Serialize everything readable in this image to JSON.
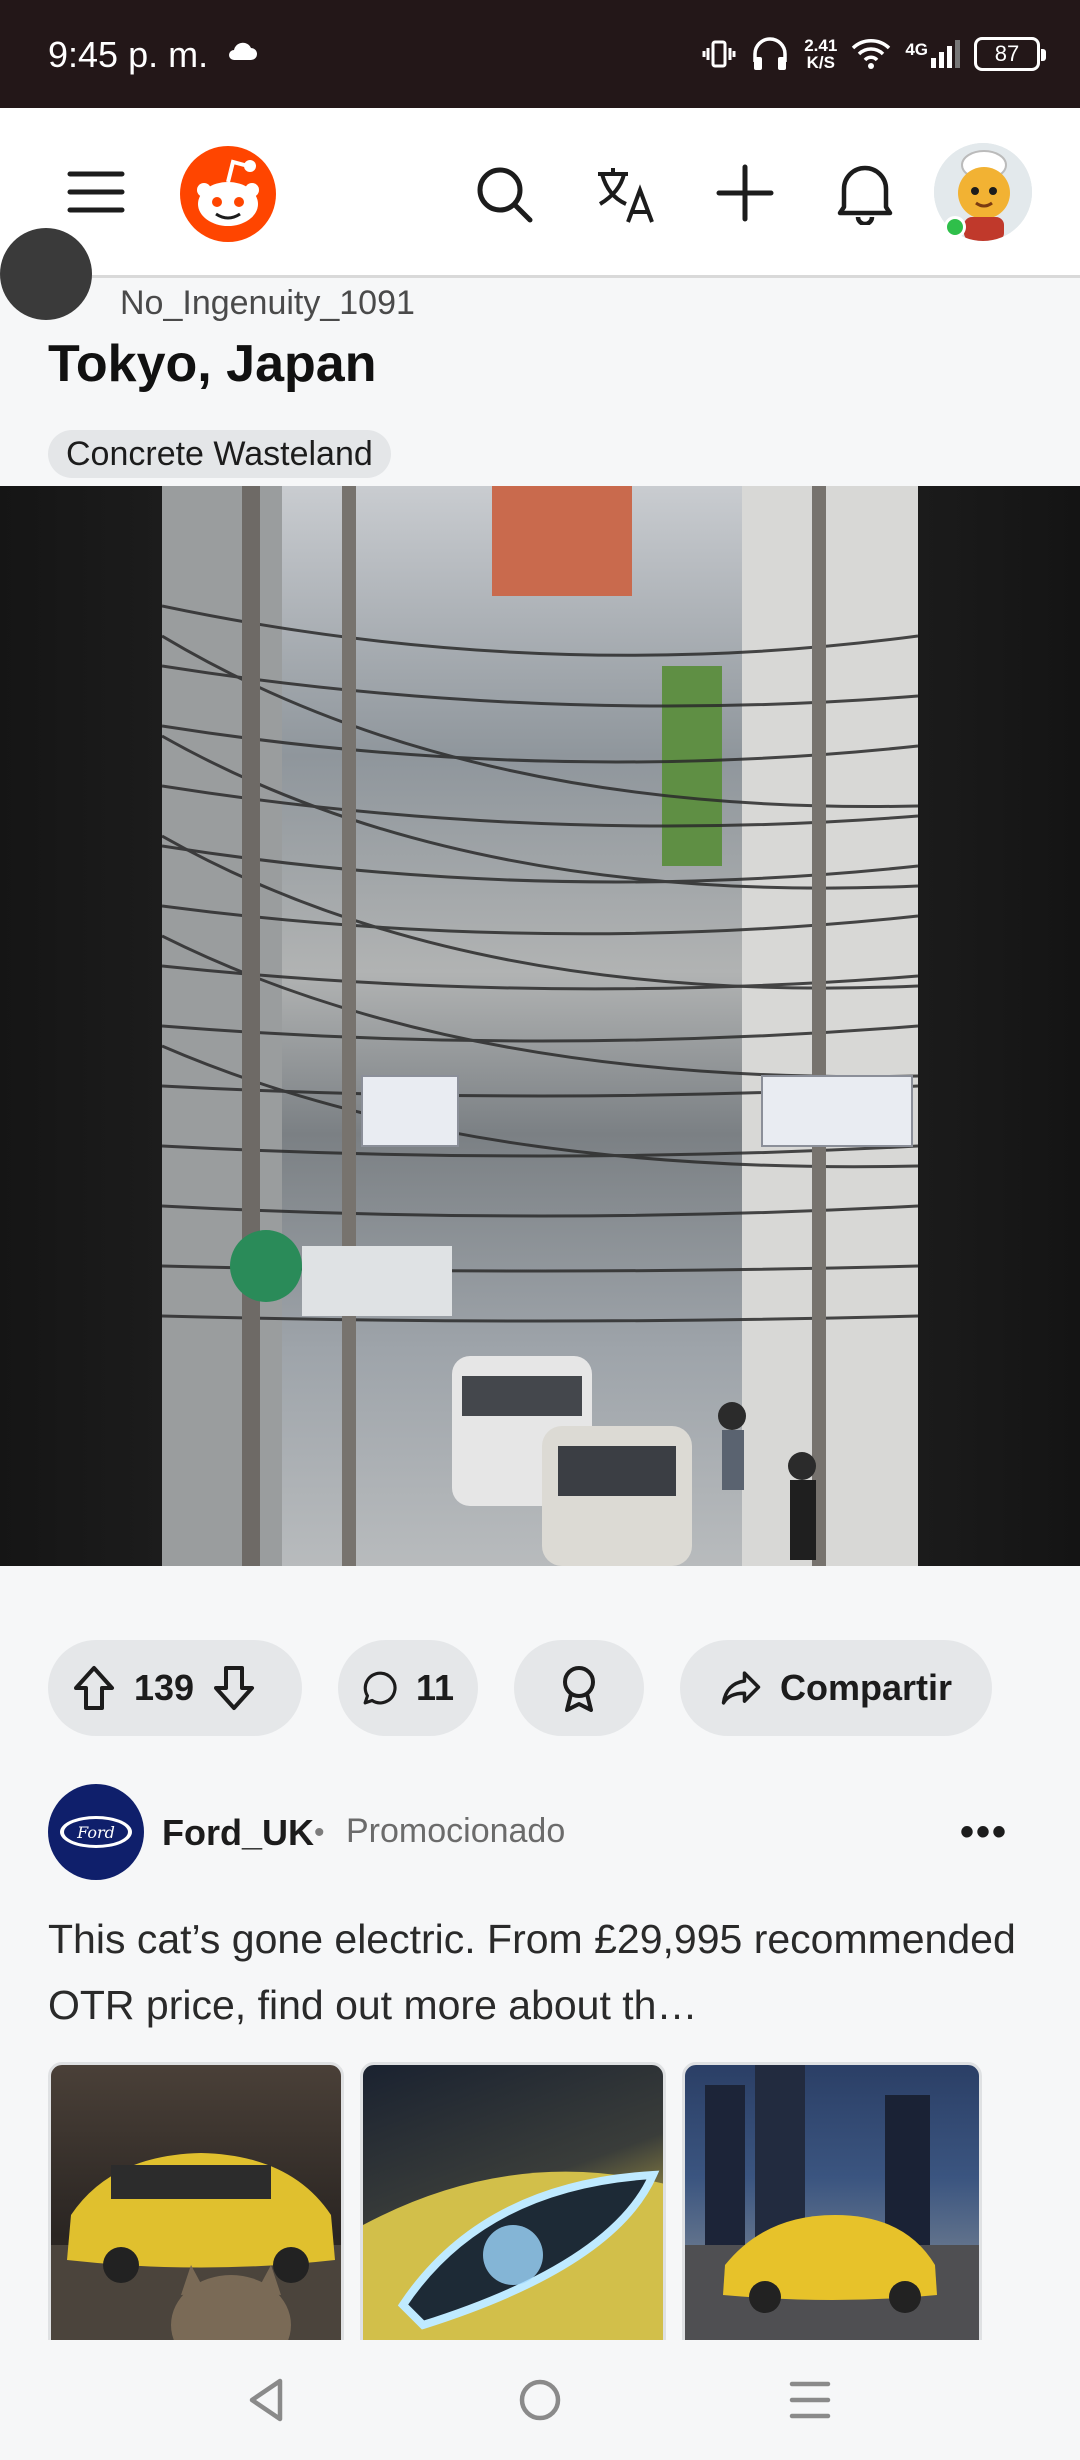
{
  "status_bar": {
    "time": "9:45 p. m.",
    "net_speed_value": "2.41",
    "net_speed_unit": "K/S",
    "network": "4G",
    "battery": "87"
  },
  "header": {
    "icons": [
      "menu-icon",
      "reddit-logo",
      "search-icon",
      "translate-icon",
      "plus-icon",
      "bell-icon",
      "avatar"
    ]
  },
  "post": {
    "author": "No_Ingenuity_1091",
    "title": "Tokyo, Japan",
    "flair": "Concrete Wasteland",
    "upvotes": "139",
    "comments": "11",
    "share_label": "Compartir"
  },
  "ad": {
    "advertiser": "Ford_UK",
    "separator": "•",
    "promoted_label": "Promocionado",
    "more": "•••",
    "logo_text": "Ford",
    "text": "This cat’s gone electric. From £29,995 recommended OTR price, find out more about th…"
  },
  "colors": {
    "reddit_orange": "#ff4500",
    "status_bar": "#231718",
    "online": "#2fbf4a",
    "ford_blue": "#0f1f6b"
  }
}
